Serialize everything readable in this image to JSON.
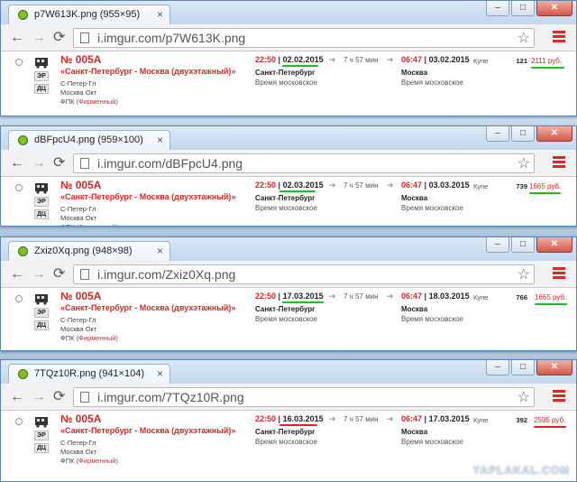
{
  "windows": [
    {
      "tab_title": "p7W613K.png (955×95)",
      "url": "i.imgur.com/p7W613K.png",
      "dep_date": "02.02.2015",
      "arr_date": "03.02.2015",
      "seats": "121",
      "price": "2111 руб.",
      "underline_color": "#19c21a",
      "date_underline_color": "#19c21a"
    },
    {
      "tab_title": "dBFpcU4.png (959×100)",
      "url": "i.imgur.com/dBFpcU4.png",
      "dep_date": "02.03.2015",
      "arr_date": "03.03.2015",
      "seats": "739",
      "price": "1665 руб.",
      "underline_color": "#19c21a",
      "date_underline_color": "#19c21a"
    },
    {
      "tab_title": "Zxiz0Xq.png (948×98)",
      "url": "i.imgur.com/Zxiz0Xq.png",
      "dep_date": "17.03.2015",
      "arr_date": "18.03.2015",
      "seats": "766",
      "price": "1665 руб.",
      "underline_color": "#19c21a",
      "date_underline_color": "#19c21a"
    },
    {
      "tab_title": "7TQz10R.png (941×104)",
      "url": "i.imgur.com/7TQz10R.png",
      "dep_date": "16.03.2015",
      "arr_date": "17.03.2015",
      "seats": "392",
      "price": "2595 руб.",
      "underline_color": "#e41f1f",
      "date_underline_color": "#e41f1f"
    }
  ],
  "train": {
    "number": "№ 005А",
    "name": "«Санкт-Петербург - Москва (двухэтажный)»",
    "from_station": "С-Петер-Гл",
    "to_station": "Москва Окт",
    "operator": "ФПК",
    "brand": "(Фирменный)",
    "badge_er": "ЭР",
    "badge_dc": "ДЦ"
  },
  "trip": {
    "dep_time": "22:50",
    "dep_city": "Санкт-Петербург",
    "duration": "7 ч 57 мин",
    "arr_time": "06:47",
    "arr_city": "Москва",
    "timezone": "Время московское",
    "car_class": "Купе",
    "separator": "|",
    "arrow": "➔"
  },
  "watermark": "YAPLAKAL.COM",
  "colors": {
    "accent_red": "#d72828",
    "menu_red": "#d42a2a",
    "favicon_green": "#85bf25"
  },
  "icons": {
    "back": "←",
    "forward": "→",
    "reload": "⟳",
    "star": "☆",
    "tab_close": "×"
  }
}
